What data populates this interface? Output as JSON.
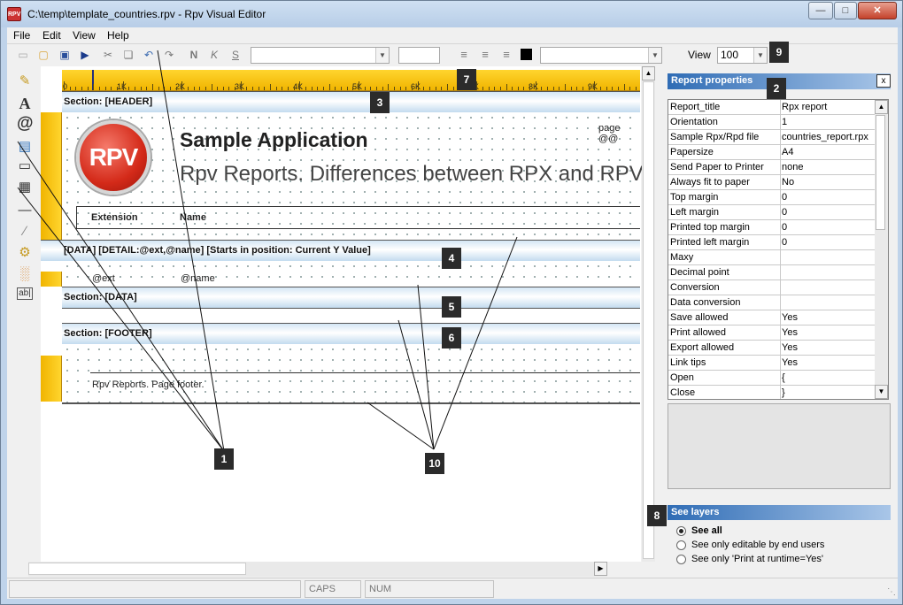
{
  "window": {
    "title": "C:\\temp\\template_countries.rpv - Rpv Visual Editor",
    "app_icon_text": "RPV"
  },
  "menu": [
    "File",
    "Edit",
    "View",
    "Help"
  ],
  "toolbar": {
    "font_name": "",
    "font_size": "",
    "view_label": "View",
    "zoom": "100",
    "format_glyphs": {
      "bold": "N",
      "italic": "K",
      "underline": "S"
    }
  },
  "ruler": {
    "labels": [
      "0",
      "1K",
      "2K",
      "3K",
      "4K",
      "5K",
      "6K",
      "7K",
      "8K",
      "9K"
    ]
  },
  "report": {
    "header_section": "Section: [HEADER]",
    "logo_text": "RPV",
    "app_title": "Sample Application",
    "app_subtitle": "Rpv Reports. Differences between RPX and RPV",
    "page_label": "page @@",
    "col_extension": "Extension",
    "col_name": "Name",
    "detail_section": "[DATA] [DETAIL:@ext,@name] [Starts in position: Current Y Value]",
    "field_ext": "@ext",
    "field_name": "@name",
    "data_section": "Section: [DATA]",
    "footer_section": "Section: [FOOTER]",
    "footer_text": "Rpv Reports. Page footer."
  },
  "properties": {
    "title": "Report properties",
    "close": "x",
    "rows": [
      {
        "key": "Report_title",
        "value": "Rpx report"
      },
      {
        "key": "Orientation",
        "value": "1"
      },
      {
        "key": "Sample Rpx/Rpd file",
        "value": "countries_report.rpx"
      },
      {
        "key": "Papersize",
        "value": "A4"
      },
      {
        "key": "Send Paper to Printer",
        "value": "none"
      },
      {
        "key": "Always fit to paper",
        "value": "No"
      },
      {
        "key": "Top margin",
        "value": "0"
      },
      {
        "key": "Left margin",
        "value": "0"
      },
      {
        "key": "Printed top margin",
        "value": "0"
      },
      {
        "key": "Printed left margin",
        "value": "0"
      },
      {
        "key": "Maxy",
        "value": ""
      },
      {
        "key": "Decimal point",
        "value": ""
      },
      {
        "key": "Conversion",
        "value": ""
      },
      {
        "key": "Data conversion",
        "value": ""
      },
      {
        "key": "Save allowed",
        "value": "Yes"
      },
      {
        "key": "Print allowed",
        "value": "Yes"
      },
      {
        "key": "Export allowed",
        "value": "Yes"
      },
      {
        "key": "Link tips",
        "value": "Yes"
      },
      {
        "key": "Open",
        "value": "{"
      },
      {
        "key": "Close",
        "value": "}"
      }
    ]
  },
  "layers": {
    "title": "See layers",
    "options": [
      "See all",
      "See only editable by end users",
      "See only 'Print at runtime=Yes'"
    ],
    "selected": 0
  },
  "status": {
    "caps": "CAPS",
    "num": "NUM"
  },
  "callouts": [
    "1",
    "2",
    "3",
    "4",
    "5",
    "6",
    "7",
    "8",
    "9",
    "10"
  ]
}
